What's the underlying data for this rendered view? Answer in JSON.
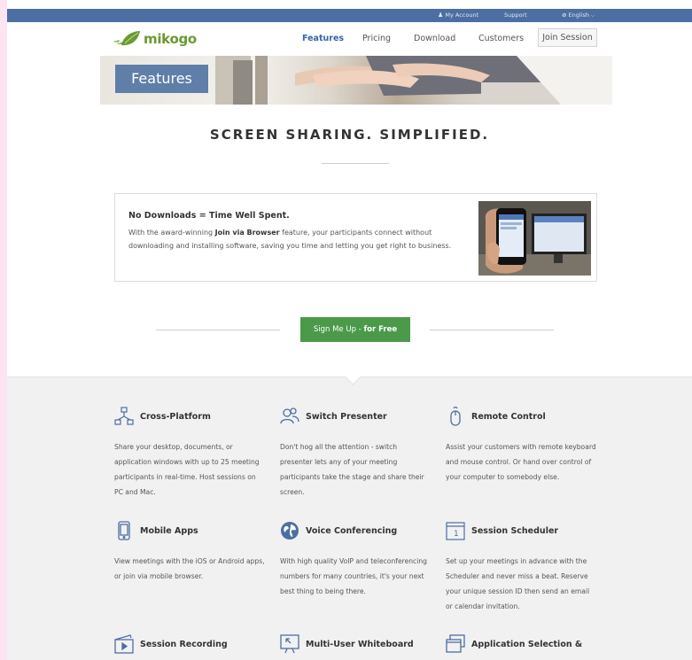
{
  "topbar": {
    "my_account": "My Account",
    "support": "Support",
    "language": "English",
    "color": "#4d6ea2"
  },
  "header": {
    "logo_text": "mikogo",
    "nav": [
      {
        "label": "Features",
        "active": true
      },
      {
        "label": "Pricing",
        "active": false
      },
      {
        "label": "Download",
        "active": false
      },
      {
        "label": "Customers",
        "active": false
      }
    ],
    "join_session": "Join Session"
  },
  "banner": {
    "label": "Features"
  },
  "tagline": "SCREEN SHARING. SIMPLIFIED.",
  "callout": {
    "title": "No Downloads = Time Well Spent.",
    "body_before": "With the award-winning ",
    "body_bold": "Join via Browser",
    "body_after": " feature, your participants connect without downloading and installing software, saving you time and letting you get right to business."
  },
  "cta": {
    "label": "Sign Me Up - ",
    "label_bold": "for Free",
    "color": "#4a9a4a"
  },
  "features": [
    {
      "icon": "cross-platform-icon",
      "title": "Cross-Platform",
      "desc": "Share your desktop, documents, or application windows with up to 25 meeting participants in real-time. Host sessions on PC and Mac."
    },
    {
      "icon": "switch-presenter-icon",
      "title": "Switch Presenter",
      "desc": "Don't hog all the attention - switch presenter lets any of your meeting participants take the stage and share their screen."
    },
    {
      "icon": "remote-control-icon",
      "title": "Remote Control",
      "desc": "Assist your customers with remote keyboard and mouse control. Or hand over control of your computer to somebody else."
    },
    {
      "icon": "mobile-apps-icon",
      "title": "Mobile Apps",
      "desc": "View meetings with the iOS or Android apps, or join via mobile browser."
    },
    {
      "icon": "voice-conferencing-icon",
      "title": "Voice Conferencing",
      "desc": "With high quality VoIP and teleconferencing numbers for many countries, it's your next best thing to being there."
    },
    {
      "icon": "session-scheduler-icon",
      "title": "Session Scheduler",
      "desc": "Set up your meetings in advance with the Scheduler and never miss a beat. Reserve your unique session ID then send an email or calendar invitation."
    },
    {
      "icon": "session-recording-icon",
      "title": "Session Recording",
      "desc": ""
    },
    {
      "icon": "whiteboard-icon",
      "title": "Multi-User Whiteboard",
      "desc": ""
    },
    {
      "icon": "application-selection-icon",
      "title": "Application Selection &",
      "desc": ""
    }
  ]
}
